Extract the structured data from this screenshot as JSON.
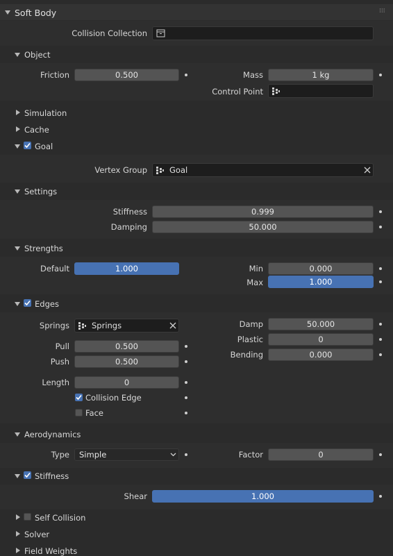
{
  "panel": {
    "title": "Soft Body"
  },
  "collision_collection": {
    "label": "Collision Collection"
  },
  "object": {
    "title": "Object",
    "friction_label": "Friction",
    "friction_value": "0.500",
    "mass_label": "Mass",
    "mass_value": "1 kg",
    "control_point_label": "Control Point"
  },
  "simulation": {
    "title": "Simulation"
  },
  "cache": {
    "title": "Cache"
  },
  "goal": {
    "title": "Goal",
    "vertex_group_label": "Vertex Group",
    "vertex_group_value": "Goal"
  },
  "settings": {
    "title": "Settings",
    "stiffness_label": "Stiffness",
    "stiffness_value": "0.999",
    "damping_label": "Damping",
    "damping_value": "50.000"
  },
  "strengths": {
    "title": "Strengths",
    "default_label": "Default",
    "default_value": "1.000",
    "min_label": "Min",
    "min_value": "0.000",
    "max_label": "Max",
    "max_value": "1.000"
  },
  "edges": {
    "title": "Edges",
    "springs_label": "Springs",
    "springs_value": "Springs",
    "pull_label": "Pull",
    "pull_value": "0.500",
    "push_label": "Push",
    "push_value": "0.500",
    "length_label": "Length",
    "length_value": "0",
    "collision_edge_label": "Collision Edge",
    "face_label": "Face",
    "damp_label": "Damp",
    "damp_value": "50.000",
    "plastic_label": "Plastic",
    "plastic_value": "0",
    "bending_label": "Bending",
    "bending_value": "0.000"
  },
  "aerodynamics": {
    "title": "Aerodynamics",
    "type_label": "Type",
    "type_value": "Simple",
    "factor_label": "Factor",
    "factor_value": "0"
  },
  "stiffness": {
    "title": "Stiffness",
    "shear_label": "Shear",
    "shear_value": "1.000"
  },
  "self_collision": {
    "title": "Self Collision"
  },
  "solver": {
    "title": "Solver"
  },
  "field_weights": {
    "title": "Field Weights"
  },
  "colors": {
    "accent": "#4772b3",
    "panel_bg": "#2e2e2e",
    "field_bg": "#545454",
    "dark_field_bg": "#1d1d1d"
  }
}
